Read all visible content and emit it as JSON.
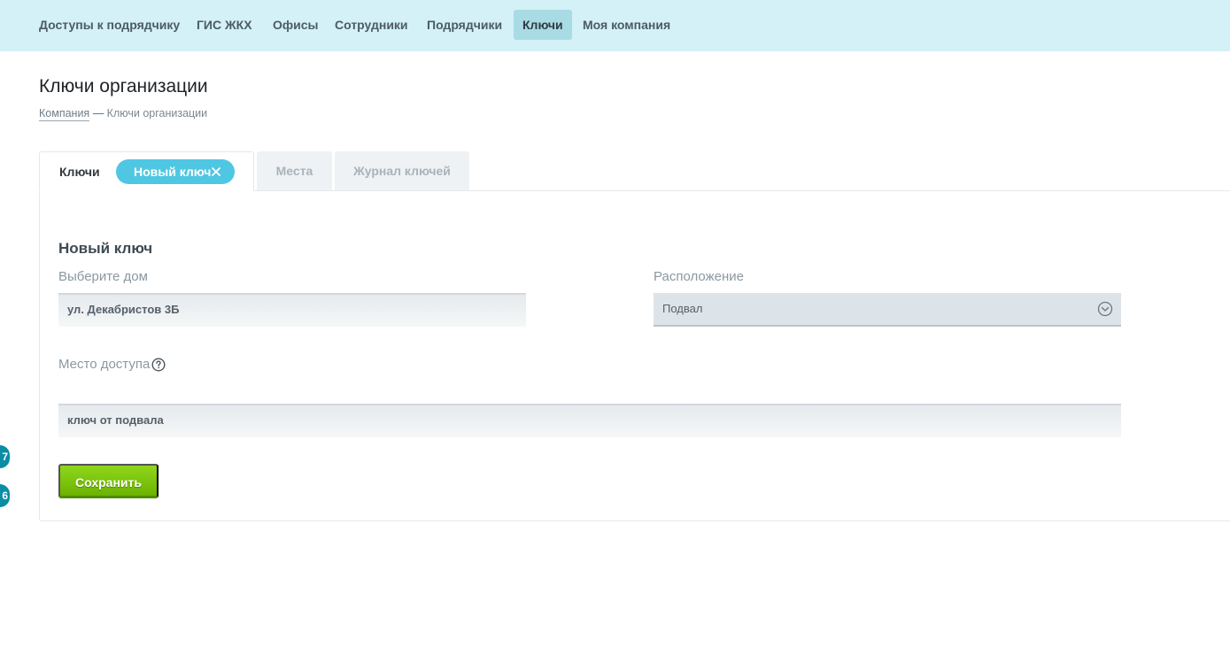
{
  "nav": {
    "items": [
      {
        "label": "Доступы к подрядчику",
        "active": false
      },
      {
        "label": "ГИС ЖКХ",
        "active": false
      },
      {
        "label": "Офисы",
        "active": false
      },
      {
        "label": "Сотрудники",
        "active": false
      },
      {
        "label": "Подрядчики",
        "active": false
      },
      {
        "label": "Ключи",
        "active": true
      },
      {
        "label": "Моя компания",
        "active": false
      }
    ]
  },
  "page": {
    "title": "Ключи организации",
    "breadcrumb": {
      "link": "Компания",
      "separator": "—",
      "current": "Ключи организации"
    }
  },
  "tabs": {
    "active_label": "Ключи",
    "chip_label": "Новый ключ",
    "places_label": "Места",
    "log_label": "Журнал ключей"
  },
  "form": {
    "title": "Новый ключ",
    "house_label": "Выберите дом",
    "house_value": "ул. Декабристов 3Б",
    "location_label": "Расположение",
    "location_value": "Подвал",
    "access_label": "Место доступа",
    "access_value": "ключ от подвала",
    "save_label": "Сохранить"
  },
  "badges": [
    "7",
    "6"
  ],
  "colors": {
    "nav_bg": "#d3f1f7",
    "nav_active_bg": "#a9dbe5",
    "chip": "#4fc7e3",
    "save_button": "#7cc30c",
    "badge": "#0b8ca5"
  },
  "icons": [
    "close-icon",
    "chevron-down-icon",
    "help-icon"
  ]
}
